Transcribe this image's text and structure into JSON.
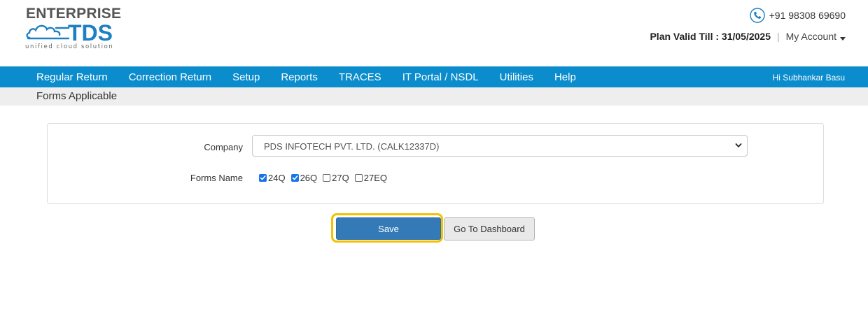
{
  "logo": {
    "line1": "ENTERPRISE",
    "brand": "TDS",
    "tagline": "unified cloud solution"
  },
  "header": {
    "phone": "+91 98308 69690",
    "plan": "Plan Valid Till : 31/05/2025",
    "separator": "|",
    "my_account": "My Account"
  },
  "nav": {
    "items": [
      "Regular Return",
      "Correction Return",
      "Setup",
      "Reports",
      "TRACES",
      "IT Portal / NSDL",
      "Utilities",
      "Help"
    ],
    "greeting": "Hi Subhankar Basu"
  },
  "breadcrumb": "Forms Applicable",
  "form": {
    "company_label": "Company",
    "company_value": "PDS INFOTECH PVT. LTD. (CALK12337D)",
    "forms_label": "Forms Name",
    "forms": [
      {
        "label": "24Q",
        "checked": true
      },
      {
        "label": "26Q",
        "checked": true
      },
      {
        "label": "27Q",
        "checked": false
      },
      {
        "label": "27EQ",
        "checked": false
      }
    ]
  },
  "actions": {
    "save": "Save",
    "dashboard": "Go To Dashboard"
  },
  "colors": {
    "nav_bg": "#0b8ccc",
    "brand_blue": "#1e7fc2",
    "save_bg": "#337ab7",
    "highlight": "#f2c100",
    "check_blue": "#1a73e8"
  },
  "icons": {
    "phone": "phone-icon",
    "caret": "caret-down-icon",
    "select": "chevron-down-icon",
    "check": "check-icon"
  }
}
